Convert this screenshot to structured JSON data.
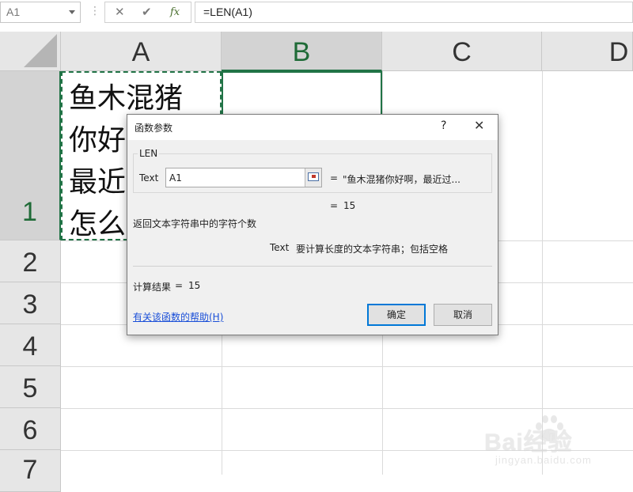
{
  "formula_bar": {
    "name_box": "A1",
    "formula": "=LEN(A1)",
    "cancel_icon": "✕",
    "enter_icon": "✔",
    "fx_icon": "fx"
  },
  "sheet": {
    "columns": [
      "A",
      "B",
      "C",
      "D"
    ],
    "rows": [
      "1",
      "2",
      "3",
      "4",
      "5",
      "6",
      "7"
    ],
    "active_column": "B",
    "active_row": "1",
    "cell_a1": "鱼木混猪\n你好\n最近\n怎么"
  },
  "dialog": {
    "title": "函数参数",
    "help_button": "?",
    "close_button": "✕",
    "function_name": "LEN",
    "arg_label": "Text",
    "arg_value": "A1",
    "arg_eq": "=",
    "arg_result": "\"鱼木混猪你好啊，最近过...",
    "result_eq": "=",
    "result_value": "15",
    "function_description": "返回文本字符串中的字符个数",
    "arg_desc_name": "Text",
    "arg_desc_text": "要计算长度的文本字符串；包括空格",
    "calc_label": "计算结果",
    "calc_eq": "=",
    "calc_value": "15",
    "help_link": "有关该函数的帮助(H)",
    "ok_label": "确定",
    "cancel_label": "取消"
  },
  "watermark": {
    "logo": "Bai经验",
    "url": "jingyan.baidu.com"
  },
  "colors": {
    "accent": "#217346",
    "link": "#1a4fd8",
    "ok_border": "#0078d7"
  }
}
